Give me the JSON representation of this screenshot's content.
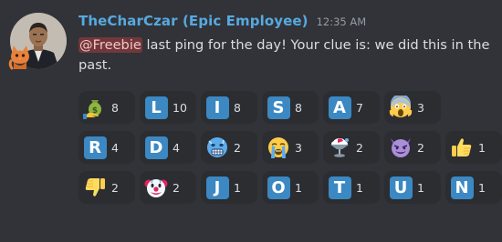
{
  "message": {
    "author": {
      "name": "TheCharCzar (Epic Employee)",
      "name_color": "#57a9e0"
    },
    "timestamp": "12:35 AM",
    "mention": "@Freebie",
    "text": " last ping for the day! Your clue is: we did this in the past."
  },
  "colors": {
    "background": "#313338",
    "reaction_bg": "#2b2d31",
    "letter_tile": "#3b88c3",
    "mention_bg": "#5c2e33"
  },
  "reaction_rows": [
    [
      {
        "emoji": "money-bag-hand-icon",
        "count": "8"
      },
      {
        "letter": "L",
        "count": "10"
      },
      {
        "letter": "I",
        "count": "8"
      },
      {
        "letter": "S",
        "count": "8"
      },
      {
        "letter": "A",
        "count": "7"
      },
      {
        "emoji": "screaming-face-icon",
        "count": "3"
      }
    ],
    [
      {
        "letter": "R",
        "count": "4"
      },
      {
        "letter": "D",
        "count": "4"
      },
      {
        "emoji": "cold-face-icon",
        "count": "2"
      },
      {
        "emoji": "loudly-crying-face-icon",
        "count": "3"
      },
      {
        "emoji": "shaved-ice-icon",
        "count": "2"
      },
      {
        "emoji": "smiling-imp-icon",
        "count": "2"
      },
      {
        "emoji": "thumbs-up-icon",
        "count": "1"
      }
    ],
    [
      {
        "emoji": "thumbs-down-icon",
        "count": "2"
      },
      {
        "emoji": "clown-face-icon",
        "count": "2"
      },
      {
        "letter": "J",
        "count": "1"
      },
      {
        "letter": "O",
        "count": "1"
      },
      {
        "letter": "T",
        "count": "1"
      },
      {
        "letter": "U",
        "count": "1"
      },
      {
        "letter": "N",
        "count": "1"
      }
    ]
  ]
}
